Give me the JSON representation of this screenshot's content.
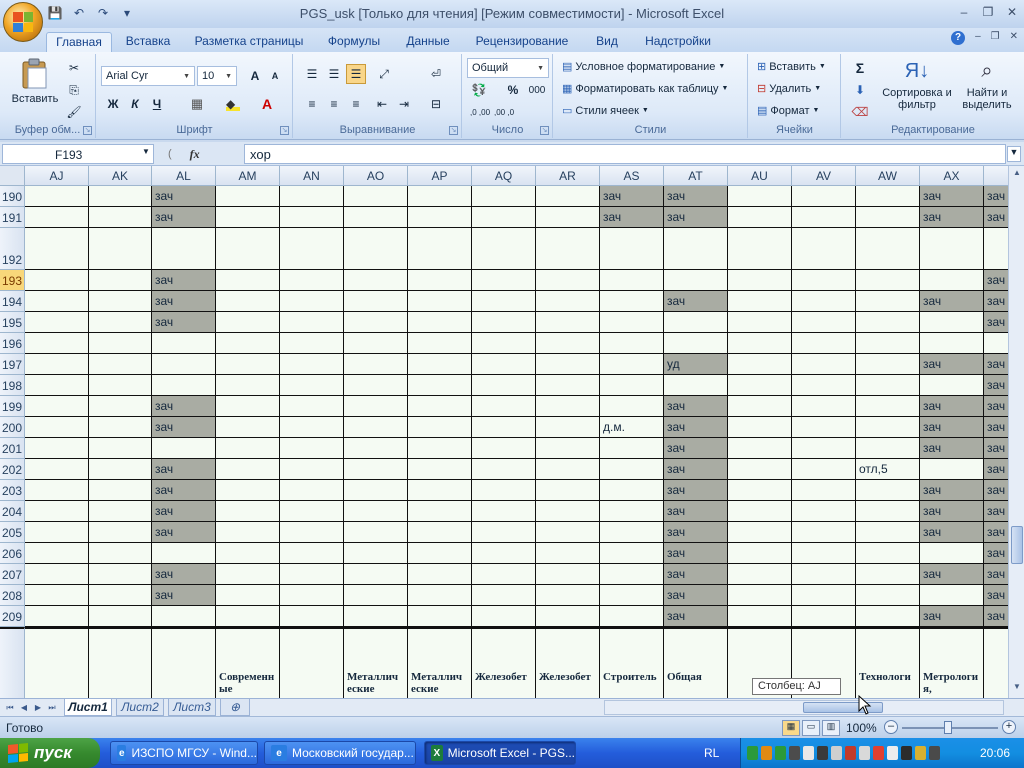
{
  "window": {
    "title": "PGS_usk  [Только для чтения]  [Режим совместимости] - Microsoft Excel",
    "controls": {
      "minimize": "–",
      "restore": "❐",
      "close": "✕"
    }
  },
  "quick_access": {
    "save": "💾",
    "undo": "↶",
    "redo": "↷",
    "customize": "▾"
  },
  "ribbon_tabs": [
    {
      "label": "Главная",
      "active": true
    },
    {
      "label": "Вставка"
    },
    {
      "label": "Разметка страницы"
    },
    {
      "label": "Формулы"
    },
    {
      "label": "Данные"
    },
    {
      "label": "Рецензирование"
    },
    {
      "label": "Вид"
    },
    {
      "label": "Надстройки"
    }
  ],
  "ribbon": {
    "clipboard": {
      "label": "Буфер обм...",
      "paste": "Вставить"
    },
    "font": {
      "label": "Шрифт",
      "font_name": "Arial Cyr",
      "font_size": "10",
      "bold": "Ж",
      "italic": "К",
      "underline": "Ч",
      "grow": "A",
      "shrink": "A"
    },
    "alignment": {
      "label": "Выравнивание"
    },
    "number": {
      "label": "Число",
      "format": "Общий",
      "percent": "%",
      "thousands": "000",
      "inc_dec": ",0 ,00",
      "dec_dec": ",00 ,0"
    },
    "styles": {
      "label": "Стили",
      "conditional": "Условное форматирование",
      "as_table": "Форматировать как таблицу",
      "cell_styles": "Стили ячеек"
    },
    "cells": {
      "label": "Ячейки",
      "insert": "Вставить",
      "delete": "Удалить",
      "format": "Формат"
    },
    "editing": {
      "label": "Редактирование",
      "sum": "Σ",
      "sort": "Сортировка и фильтр",
      "find": "Найти и выделить"
    }
  },
  "formula_bar": {
    "name_box": "F193",
    "fx": "fx",
    "value": "хор"
  },
  "columns": [
    "AJ",
    "AK",
    "AL",
    "AM",
    "AN",
    "AO",
    "AP",
    "AQ",
    "AR",
    "AS",
    "AT",
    "AU",
    "AV",
    "AW",
    "AX"
  ],
  "rows": [
    {
      "num": "190",
      "cells": {
        "AL": "зач",
        "AS": "зач",
        "AT": "зач",
        "AX": "зач",
        "AY": "зач"
      }
    },
    {
      "num": "191",
      "cells": {
        "AL": "зач",
        "AS": "зач",
        "AT": "зач",
        "AX": "зач",
        "AY": "зач"
      }
    },
    {
      "num": "192",
      "cells": {}
    },
    {
      "num": "193",
      "cells": {
        "AL": "зач",
        "AY": "зач"
      }
    },
    {
      "num": "194",
      "cells": {
        "AL": "зач",
        "AT": "зач",
        "AX": "зач",
        "AY": "зач"
      }
    },
    {
      "num": "195",
      "cells": {
        "AL": "зач",
        "AY": "зач"
      }
    },
    {
      "num": "196",
      "cells": {}
    },
    {
      "num": "197",
      "cells": {
        "AT": "уд",
        "AX": "зач",
        "AY": "зач"
      }
    },
    {
      "num": "198",
      "cells": {
        "AY": "зач"
      }
    },
    {
      "num": "199",
      "cells": {
        "AL": "зач",
        "AT": "зач",
        "AX": "зач",
        "AY": "зач"
      }
    },
    {
      "num": "200",
      "cells": {
        "AL": "зач",
        "AS": "д.м.",
        "AT": "зач",
        "AX": "зач",
        "AY": "зач"
      }
    },
    {
      "num": "201",
      "cells": {
        "AT": "зач",
        "AX": "зач",
        "AY": "зач"
      }
    },
    {
      "num": "202",
      "cells": {
        "AL": "зач",
        "AT": "зач",
        "AW": "отл,5",
        "AY": "зач"
      }
    },
    {
      "num": "203",
      "cells": {
        "AL": "зач",
        "AT": "зач",
        "AX": "зач",
        "AY": "зач"
      }
    },
    {
      "num": "204",
      "cells": {
        "AL": "зач",
        "AT": "зач",
        "AX": "зач",
        "AY": "зач"
      }
    },
    {
      "num": "205",
      "cells": {
        "AL": "зач",
        "AT": "зач",
        "AX": "зач",
        "AY": "зач"
      }
    },
    {
      "num": "206",
      "cells": {
        "AT": "зач",
        "AY": "зач"
      }
    },
    {
      "num": "207",
      "cells": {
        "AL": "зач",
        "AT": "зач",
        "AX": "зач",
        "AY": "зач"
      }
    },
    {
      "num": "208",
      "cells": {
        "AL": "зач",
        "AT": "зач",
        "AY": "зач"
      }
    },
    {
      "num": "209",
      "cells": {
        "AT": "зач",
        "AX": "зач",
        "AY": "зач"
      }
    }
  ],
  "header_row": {
    "AM": "Современн ые",
    "AO": "Металлич еские",
    "AP": "Металлич еские",
    "AQ": "Железобет",
    "AR": "Железобет",
    "AS": "Строитель",
    "AT": "Общая",
    "AW": "Технологи",
    "AX": "Метрологи я,"
  },
  "sheet_tabs": [
    "Лист1",
    "Лист2",
    "Лист3"
  ],
  "active_sheet": "Лист1",
  "tooltip": "Столбец: AJ",
  "status": {
    "ready": "Готово",
    "zoom": "100%"
  },
  "taskbar": {
    "start": "пуск",
    "tasks": [
      "ИЗСПО МГСУ - Wind...",
      "Московский государ...",
      "Microsoft Excel - PGS..."
    ],
    "active_task": 2,
    "lang": "RL",
    "clock": "20:06"
  }
}
